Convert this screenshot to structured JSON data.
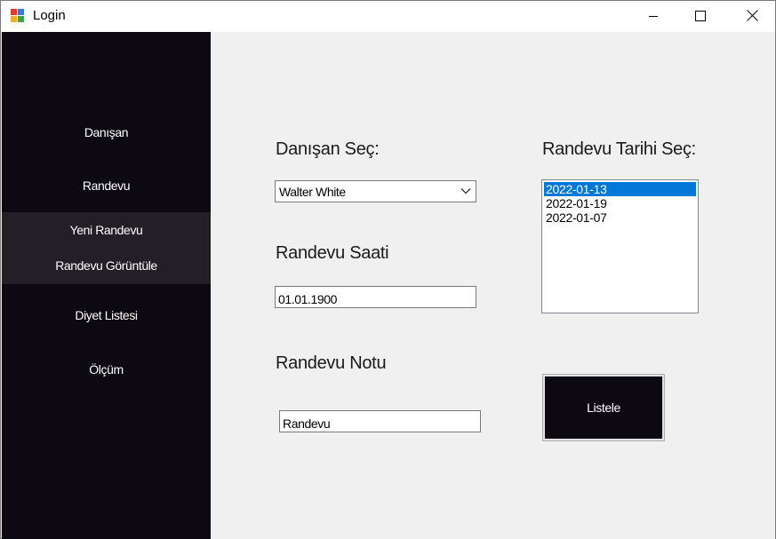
{
  "window": {
    "title": "Login",
    "icon": "app-window-icon",
    "controls": [
      "minimize-icon",
      "maximize-icon",
      "close-icon"
    ]
  },
  "sidebar": {
    "items": [
      {
        "label": "Danışan"
      },
      {
        "label": "Randevu"
      },
      {
        "label": "Diyet Listesi"
      },
      {
        "label": "Ölçüm"
      }
    ],
    "submenu": [
      {
        "label": "Yeni Randevu"
      },
      {
        "label": "Randevu Görüntüle"
      }
    ],
    "background": "#0c0912",
    "submenu_background": "#221f26"
  },
  "form": {
    "client_label": "Danışan Seç:",
    "client_selected": "Walter White",
    "time_label": "Randevu Saati",
    "time_value": "01.01.1900",
    "note_label": "Randevu Notu",
    "note_value": "Randevu",
    "date_label": "Randevu Tarihi Seç:",
    "dates": [
      {
        "value": "2022-01-13",
        "selected": true
      },
      {
        "value": "2022-01-19",
        "selected": false
      },
      {
        "value": "2022-01-07",
        "selected": false
      }
    ],
    "list_button": "Listele"
  },
  "colors": {
    "selection": "#0078d7",
    "content_background": "#f0f0f0"
  }
}
